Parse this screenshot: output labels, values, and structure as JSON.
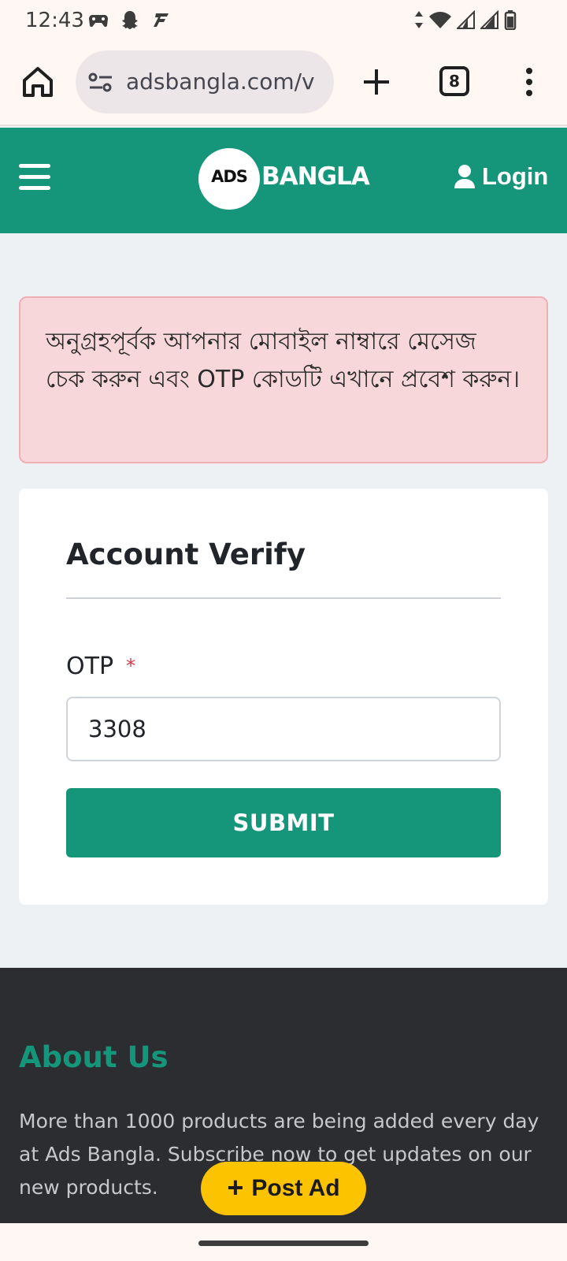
{
  "status_bar": {
    "time": "12:43",
    "icons": [
      "gamepad-icon",
      "snapchat-icon",
      "app-icon",
      "data-arrows-icon",
      "wifi-icon",
      "signal-icon",
      "signal-icon",
      "battery-icon"
    ]
  },
  "browser": {
    "url": "adsbangla.com/v",
    "tab_count": "8",
    "icons": [
      "home-icon",
      "site-settings-icon",
      "plus-icon",
      "tabs-icon",
      "more-vert-icon"
    ]
  },
  "header": {
    "logo_ads": "ADS",
    "logo_bangla": "BANGLA",
    "login_label": "Login",
    "brand_color": "#15967a"
  },
  "alert": {
    "message": "অনুগ্রহপূর্বক আপনার মোবাইল নাম্বারে মেসেজ চেক করুন এবং OTP কোডটি এখানে প্রবেশ করুন।"
  },
  "verify": {
    "title": "Account Verify",
    "otp_label": "OTP",
    "required_mark": "*",
    "otp_value": "3308",
    "submit_label": "SUBMIT"
  },
  "footer": {
    "about_title": "About Us",
    "about_text": "More than 1000 products are being added every day at Ads Bangla. Subscribe now to get updates on our new products."
  },
  "post_ad": {
    "label": "Post Ad",
    "color": "#fcc300"
  }
}
